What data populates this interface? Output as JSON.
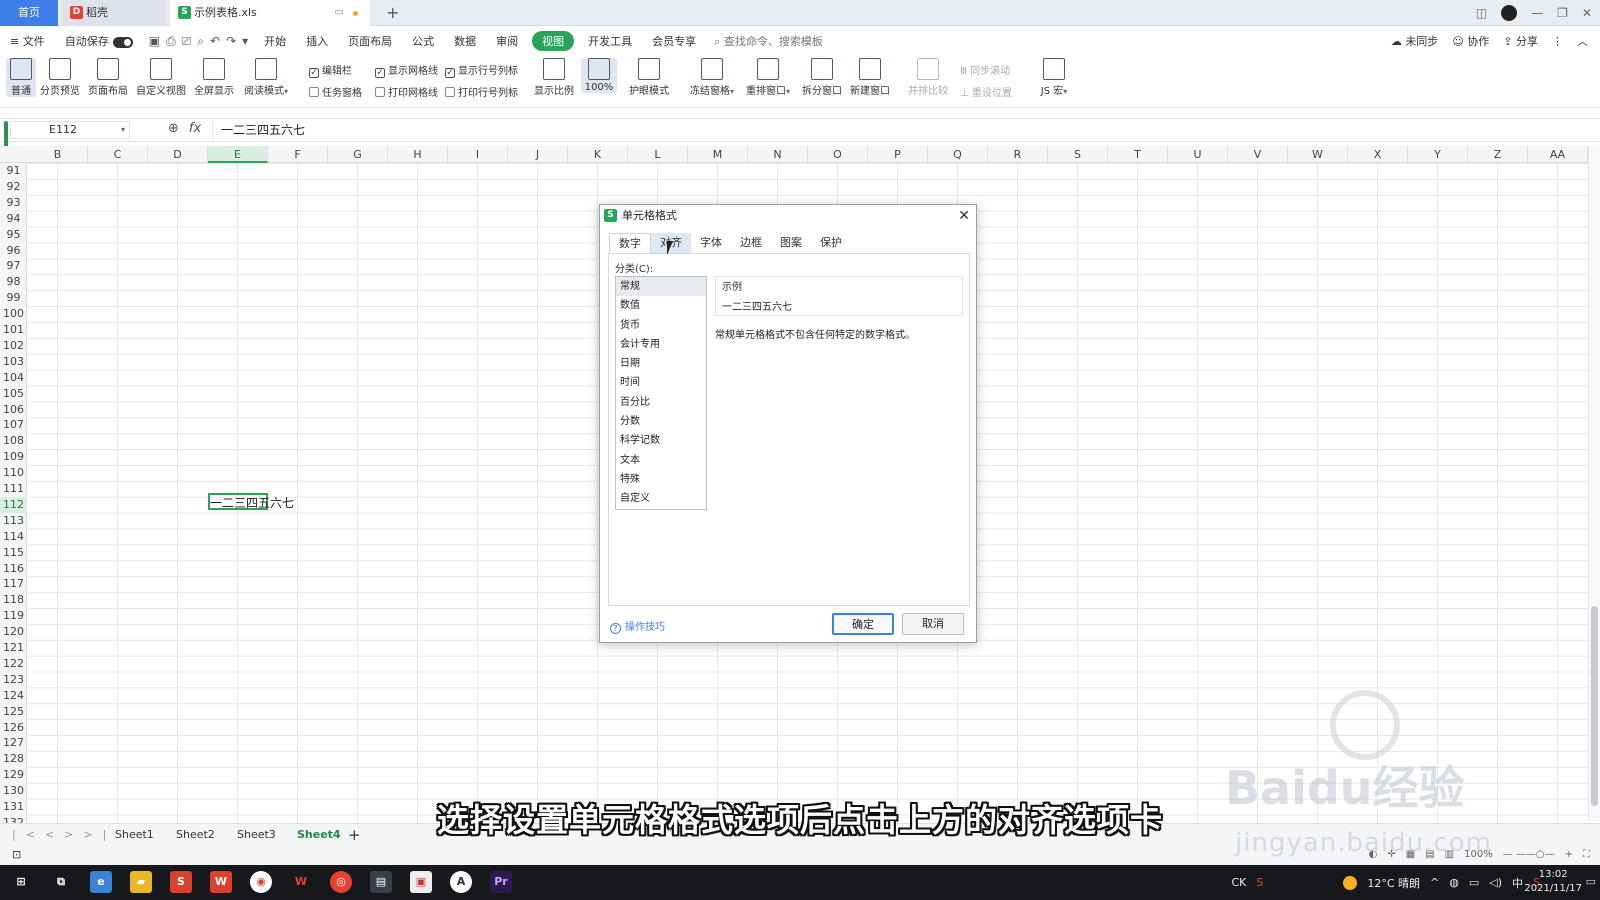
{
  "tabbar": {
    "home": "首页",
    "tabs": [
      {
        "label": "稻壳"
      },
      {
        "label": "示例表格.xls"
      }
    ],
    "add": "+"
  },
  "menubar": {
    "file": "≡ 文件",
    "autosave": "自动保存",
    "items": [
      "开始",
      "插入",
      "页面布局",
      "公式",
      "数据",
      "审阅",
      "视图",
      "开发工具",
      "会员专享"
    ],
    "active": "视图",
    "search_placeholder": "查找命令、搜索模板",
    "right": [
      "未同步",
      "协作",
      "分享"
    ]
  },
  "ribbon": {
    "buttons": [
      "普通",
      "分页预览",
      "页面布局",
      "自定义视图",
      "全屏显示",
      "阅读模式",
      "显示比例",
      "100%",
      "护眼模式",
      "冻结窗格",
      "重排窗口",
      "拆分窗口",
      "新建窗口",
      "并排比较",
      "JS 宏"
    ],
    "checks_row1": [
      "编辑栏",
      "显示网格线",
      "显示行号列标"
    ],
    "checks_row2": [
      "任务窗格",
      "打印网格线",
      "打印行号列标"
    ],
    "sync": [
      "同步滚动",
      "重设位置"
    ]
  },
  "formula_bar": {
    "cell_ref": "E112",
    "content": "一二三四五六七"
  },
  "sheet": {
    "columns": [
      "B",
      "C",
      "D",
      "E",
      "F",
      "G",
      "H",
      "I",
      "J",
      "K",
      "L",
      "M",
      "N",
      "O",
      "P",
      "Q",
      "R",
      "S",
      "T",
      "U",
      "V",
      "W",
      "X",
      "Y",
      "Z",
      "AA"
    ],
    "selected_column": "E",
    "rows": [
      "91",
      "92",
      "93",
      "94",
      "95",
      "96",
      "97",
      "98",
      "99",
      "100",
      "101",
      "102",
      "103",
      "104",
      "105",
      "106",
      "107",
      "108",
      "109",
      "110",
      "111",
      "112",
      "113",
      "114",
      "115",
      "116",
      "117",
      "118",
      "119",
      "120",
      "121",
      "122",
      "123",
      "124",
      "125",
      "126",
      "127",
      "128",
      "129",
      "130",
      "131",
      "132"
    ],
    "selected_row": "112",
    "active_cell_text": "一二三四五六七",
    "tabs": [
      "Sheet1",
      "Sheet2",
      "Sheet3",
      "Sheet4"
    ],
    "current_tab": "Sheet4"
  },
  "status": {
    "zoom": "100%"
  },
  "dialog": {
    "title": "单元格格式",
    "tabs": [
      "数字",
      "对齐",
      "字体",
      "边框",
      "图案",
      "保护"
    ],
    "current_tab": "数字",
    "hover_tab": "对齐",
    "category_label": "分类(C):",
    "categories": [
      "常规",
      "数值",
      "货币",
      "会计专用",
      "日期",
      "时间",
      "百分比",
      "分数",
      "科学记数",
      "文本",
      "特殊",
      "自定义"
    ],
    "selected_category": "常规",
    "sample_label": "示例",
    "sample_value": "一二三四五六七",
    "description": "常规单元格格式不包含任何特定的数字格式。",
    "tips": "操作技巧",
    "ok": "确定",
    "cancel": "取消"
  },
  "taskbar": {
    "weather": "12°C 晴朗",
    "lang": "中",
    "time": "13:02",
    "date": "2021/11/17",
    "ck": "CK"
  },
  "caption": "选择设置单元格格式选项后点击上方的对齐选项卡",
  "watermark": {
    "brand": "Baidu经验",
    "url": "jingyan.baidu.com"
  }
}
